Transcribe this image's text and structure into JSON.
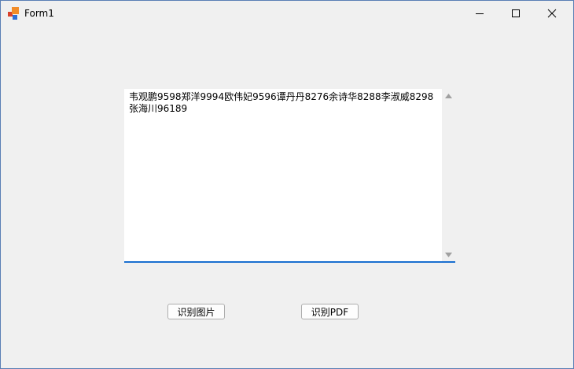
{
  "window": {
    "title": "Form1"
  },
  "textbox": {
    "content": "韦观鹏9598郑洋9994欧伟妃9596谭丹丹8276余诗华8288李淑威8298张海川96189"
  },
  "buttons": {
    "recognize_image": "识别图片",
    "recognize_pdf": "识别PDF"
  },
  "colors": {
    "focus_underline": "#1a6fd0",
    "window_border": "#5a7fb5"
  }
}
